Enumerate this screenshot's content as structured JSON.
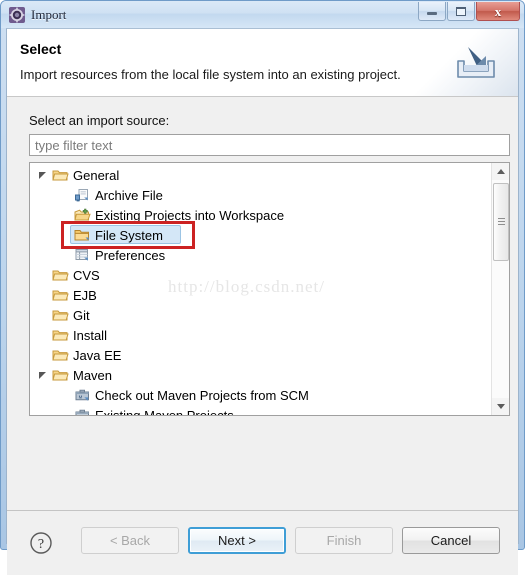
{
  "window": {
    "title": "Import",
    "title_icon": "eclipse-import-gear-icon",
    "controls": {
      "minimize": "minimize-icon",
      "maximize": "restore-icon",
      "close": "x"
    }
  },
  "header": {
    "title": "Select",
    "description": "Import resources from the local file system into an existing project.",
    "banner_icon": "import-tray-arrow-icon"
  },
  "body": {
    "source_label": "Select an import source:",
    "filter_placeholder": "type filter text",
    "filter_value": "",
    "watermark": "http://blog.csdn.net/",
    "tree": [
      {
        "label": "General",
        "level": 0,
        "state": "expanded",
        "icon": "folder-icon",
        "selected": false
      },
      {
        "label": "Archive File",
        "level": 1,
        "state": "leaf",
        "icon": "archive-file-icon",
        "selected": false
      },
      {
        "label": "Existing Projects into Workspace",
        "level": 1,
        "state": "leaf",
        "icon": "projects-folder-icon",
        "selected": false
      },
      {
        "label": "File System",
        "level": 1,
        "state": "leaf",
        "icon": "folder-open-icon",
        "selected": true
      },
      {
        "label": "Preferences",
        "level": 1,
        "state": "leaf",
        "icon": "preferences-icon",
        "selected": false
      },
      {
        "label": "CVS",
        "level": 0,
        "state": "collapsed",
        "icon": "folder-icon",
        "selected": false
      },
      {
        "label": "EJB",
        "level": 0,
        "state": "collapsed",
        "icon": "folder-icon",
        "selected": false
      },
      {
        "label": "Git",
        "level": 0,
        "state": "collapsed",
        "icon": "folder-icon",
        "selected": false
      },
      {
        "label": "Install",
        "level": 0,
        "state": "collapsed",
        "icon": "folder-icon",
        "selected": false
      },
      {
        "label": "Java EE",
        "level": 0,
        "state": "collapsed",
        "icon": "folder-icon",
        "selected": false
      },
      {
        "label": "Maven",
        "level": 0,
        "state": "expanded",
        "icon": "folder-icon",
        "selected": false
      },
      {
        "label": "Check out Maven Projects from SCM",
        "level": 1,
        "state": "leaf",
        "icon": "maven-scm-icon",
        "selected": false
      },
      {
        "label": "Existing Maven Projects",
        "level": 1,
        "state": "leaf",
        "icon": "maven-project-icon",
        "selected": false
      }
    ],
    "scrollbar": {
      "up_arrow": "scroll-up-icon",
      "down_arrow": "scroll-down-icon"
    },
    "annotation": {
      "shape": "rectangle",
      "color": "#cc2222",
      "target": "File System"
    }
  },
  "footer": {
    "help_icon": "question-mark-icon",
    "buttons": [
      {
        "label": "< Back",
        "enabled": false,
        "default": false
      },
      {
        "label": "Next >",
        "enabled": true,
        "default": true
      },
      {
        "label": "Finish",
        "enabled": false,
        "default": false
      },
      {
        "label": "Cancel",
        "enabled": true,
        "default": false
      }
    ]
  },
  "colors": {
    "accent": "#3f9ed6",
    "annotation": "#cc2222",
    "selection": "#d4e7f7",
    "folder": "#f5c76a",
    "dialog_bg": "#f0f0f0",
    "title_gradient_top": "#dbe9f7"
  }
}
